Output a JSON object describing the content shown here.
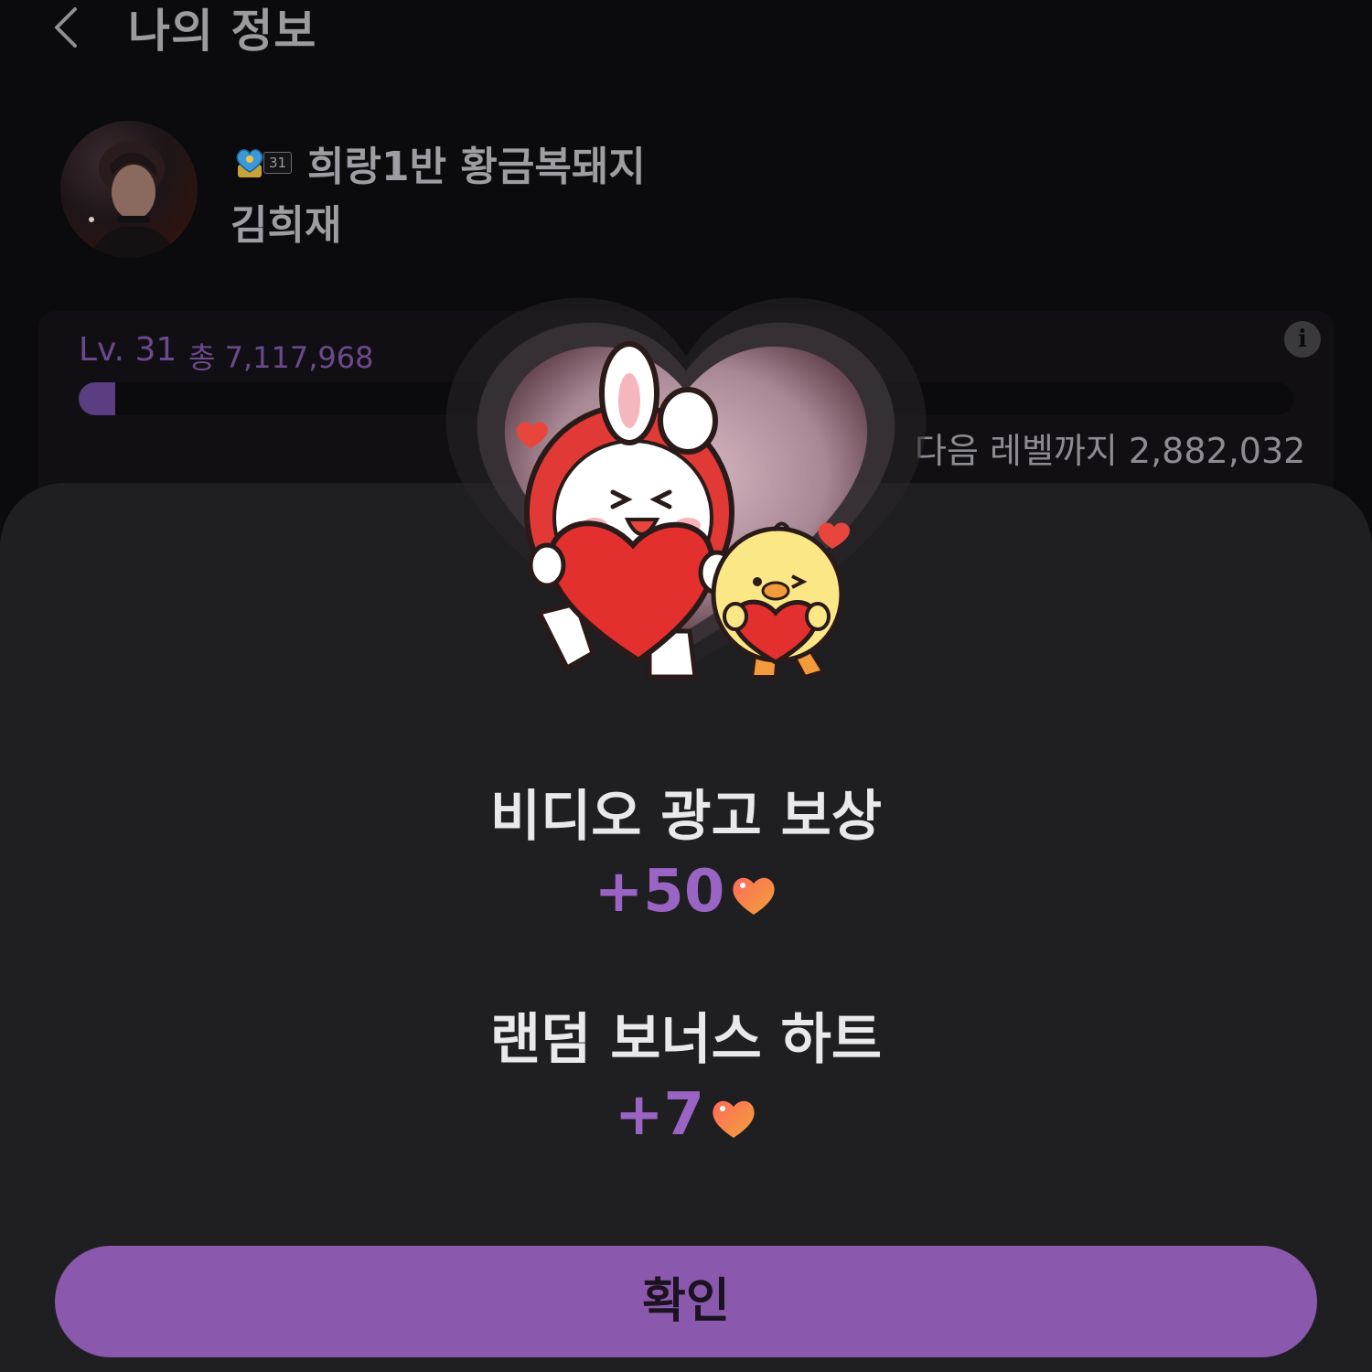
{
  "header": {
    "title": "나의 정보"
  },
  "profile": {
    "badge_level": "31",
    "nickname": "희랑1반 황금복돼지",
    "name": "김희재"
  },
  "level": {
    "label": "Lv. 31",
    "total": "총 7,117,968",
    "progress_fraction": 0.03,
    "next_level_text": "다음 레벨까지 2,882,032",
    "info_label": "i"
  },
  "reward_sheet": {
    "title1": "비디오 광고 보상",
    "amount1": "+50",
    "title2": "랜덤 보너스 하트",
    "amount2": "+7",
    "confirm_label": "확인"
  },
  "icons": {
    "back": "chevron-left-icon",
    "info": "info-icon",
    "heart": "heart-icon",
    "badge": "blue-heart-badge-icon"
  },
  "colors": {
    "accent": "#8a58ac",
    "amount_text": "#9a64c4",
    "sheet_bg": "#1f1e20",
    "heart_red": "#e8463c"
  }
}
